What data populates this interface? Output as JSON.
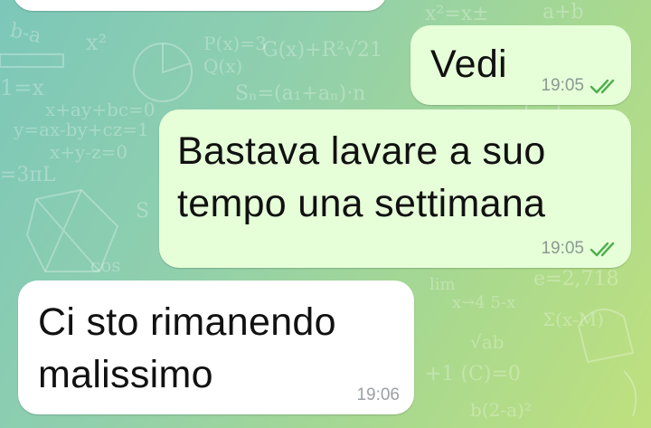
{
  "chat": {
    "messages": [
      {
        "id": "top-partial",
        "direction": "incoming",
        "text": "",
        "time": ""
      },
      {
        "id": "m1",
        "direction": "outgoing",
        "text": "Vedi",
        "time": "19:05",
        "status": "read"
      },
      {
        "id": "m2",
        "direction": "outgoing",
        "text": "Bastava lavare a suo\ntempo una settimana",
        "time": "19:05",
        "status": "read"
      },
      {
        "id": "m3",
        "direction": "incoming",
        "text": "Ci sto rimanendo\nmalissimo",
        "time": "19:06"
      }
    ]
  },
  "colors": {
    "outgoing_bubble": "#e6ffd9",
    "incoming_bubble": "#ffffff",
    "read_ticks": "#4fae4e",
    "wallpaper_start": "#7cc7b9",
    "wallpaper_end": "#bfe07e"
  },
  "icons": {
    "read_receipt": "double-check-icon"
  }
}
